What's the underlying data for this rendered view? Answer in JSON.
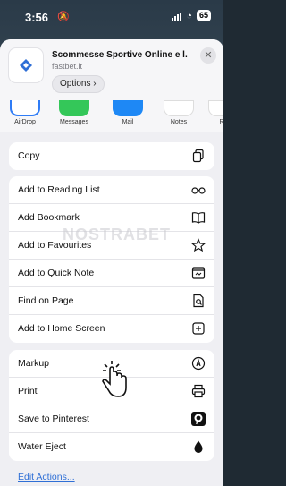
{
  "status_bar": {
    "time": "3:56",
    "battery": "65"
  },
  "header": {
    "title": "Scommesse Sportive Online e l...",
    "url": "fastbet.it",
    "options_label": "Options",
    "close_label": "✕"
  },
  "apps": [
    {
      "label": "AirDrop",
      "color": "#2f7cf6"
    },
    {
      "label": "Messages",
      "color": "#34c759"
    },
    {
      "label": "Mail",
      "color": "#1e88f5"
    },
    {
      "label": "Notes",
      "color": "#ffd54a"
    },
    {
      "label": "Re",
      "color": "#ff9f0a"
    }
  ],
  "groups": [
    {
      "items": [
        {
          "label": "Copy",
          "icon": "copy-icon"
        }
      ]
    },
    {
      "items": [
        {
          "label": "Add to Reading List",
          "icon": "glasses-icon"
        },
        {
          "label": "Add Bookmark",
          "icon": "book-icon"
        },
        {
          "label": "Add to Favourites",
          "icon": "star-icon"
        },
        {
          "label": "Add to Quick Note",
          "icon": "quick-note-icon"
        },
        {
          "label": "Find on Page",
          "icon": "find-page-icon"
        },
        {
          "label": "Add to Home Screen",
          "icon": "plus-square-icon"
        }
      ]
    },
    {
      "items": [
        {
          "label": "Markup",
          "icon": "markup-icon"
        },
        {
          "label": "Print",
          "icon": "printer-icon"
        },
        {
          "label": "Save to Pinterest",
          "icon": "pinterest-icon"
        },
        {
          "label": "Water Eject",
          "icon": "water-drop-icon"
        }
      ]
    }
  ],
  "edit_actions_label": "Edit Actions...",
  "watermark": "NOSTRABET"
}
